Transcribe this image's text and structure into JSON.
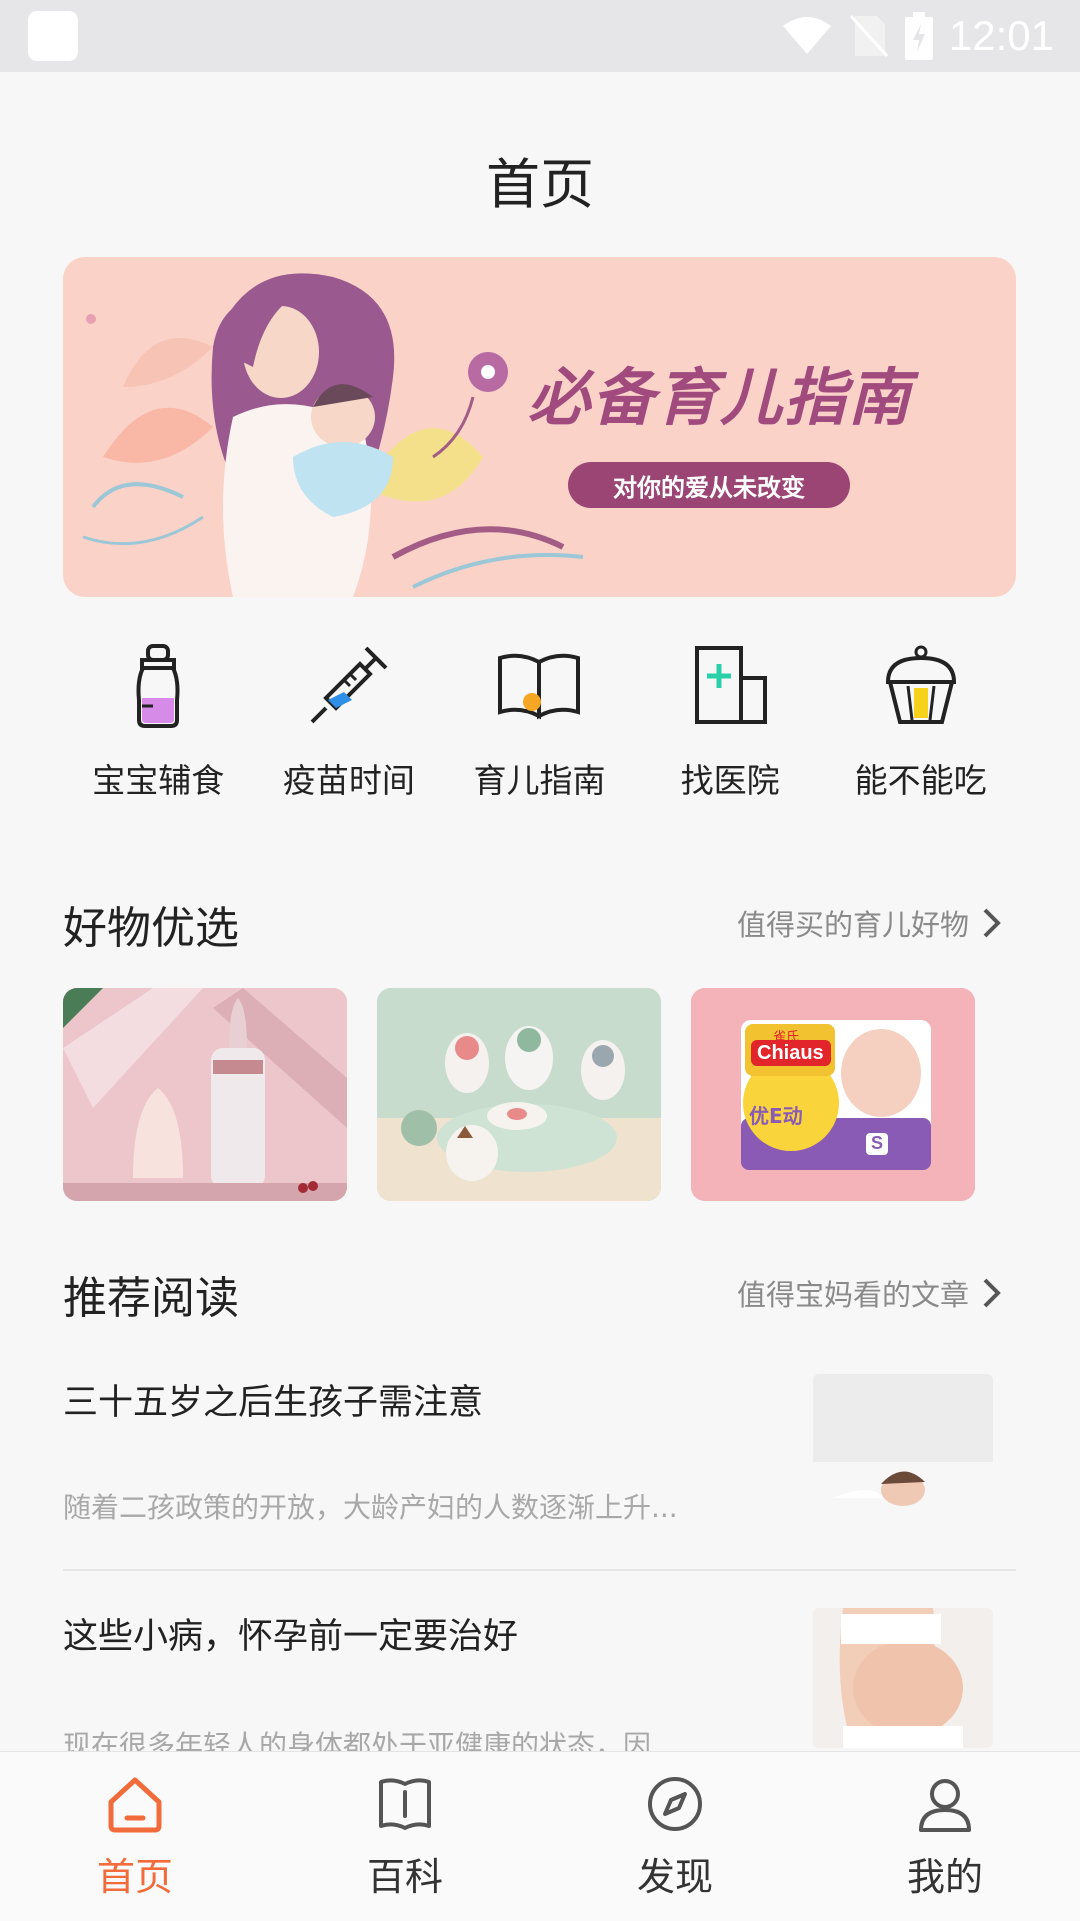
{
  "status_bar": {
    "time": "12:01"
  },
  "page": {
    "title": "首页"
  },
  "banner": {
    "title": "必备育儿指南",
    "subtitle": "对你的爱从未改变"
  },
  "quick_nav": [
    {
      "label": "宝宝辅食",
      "icon": "baby-bottle-icon"
    },
    {
      "label": "疫苗时间",
      "icon": "syringe-icon"
    },
    {
      "label": "育儿指南",
      "icon": "open-book-icon"
    },
    {
      "label": "找医院",
      "icon": "hospital-icon"
    },
    {
      "label": "能不能吃",
      "icon": "cupcake-icon"
    }
  ],
  "goods": {
    "title": "好物优选",
    "more": "值得买的育儿好物",
    "items": [
      {
        "name": "baby-bottle-product"
      },
      {
        "name": "baby-shoes-product"
      },
      {
        "name": "diaper-product",
        "brand": "Chiaus",
        "brand_cn": "雀氏",
        "series": "优E动",
        "size": "S"
      }
    ]
  },
  "reading": {
    "title": "推荐阅读",
    "more": "值得宝妈看的文章",
    "articles": [
      {
        "title": "三十五岁之后生孩子需注意",
        "summary": "随着二孩政策的开放，大龄产妇的人数逐渐上升..."
      },
      {
        "title": "这些小病，怀孕前一定要治好",
        "summary": "现在很多年轻人的身体都处于亚健康的状态，因..."
      }
    ]
  },
  "tabs": [
    {
      "label": "首页",
      "icon": "home-icon",
      "active": true
    },
    {
      "label": "百科",
      "icon": "book-icon",
      "active": false
    },
    {
      "label": "发现",
      "icon": "compass-icon",
      "active": false
    },
    {
      "label": "我的",
      "icon": "user-icon",
      "active": false
    }
  ],
  "colors": {
    "accent": "#f26b3a",
    "banner_bg": "#fbd2c8",
    "banner_text": "#a04a7e"
  }
}
